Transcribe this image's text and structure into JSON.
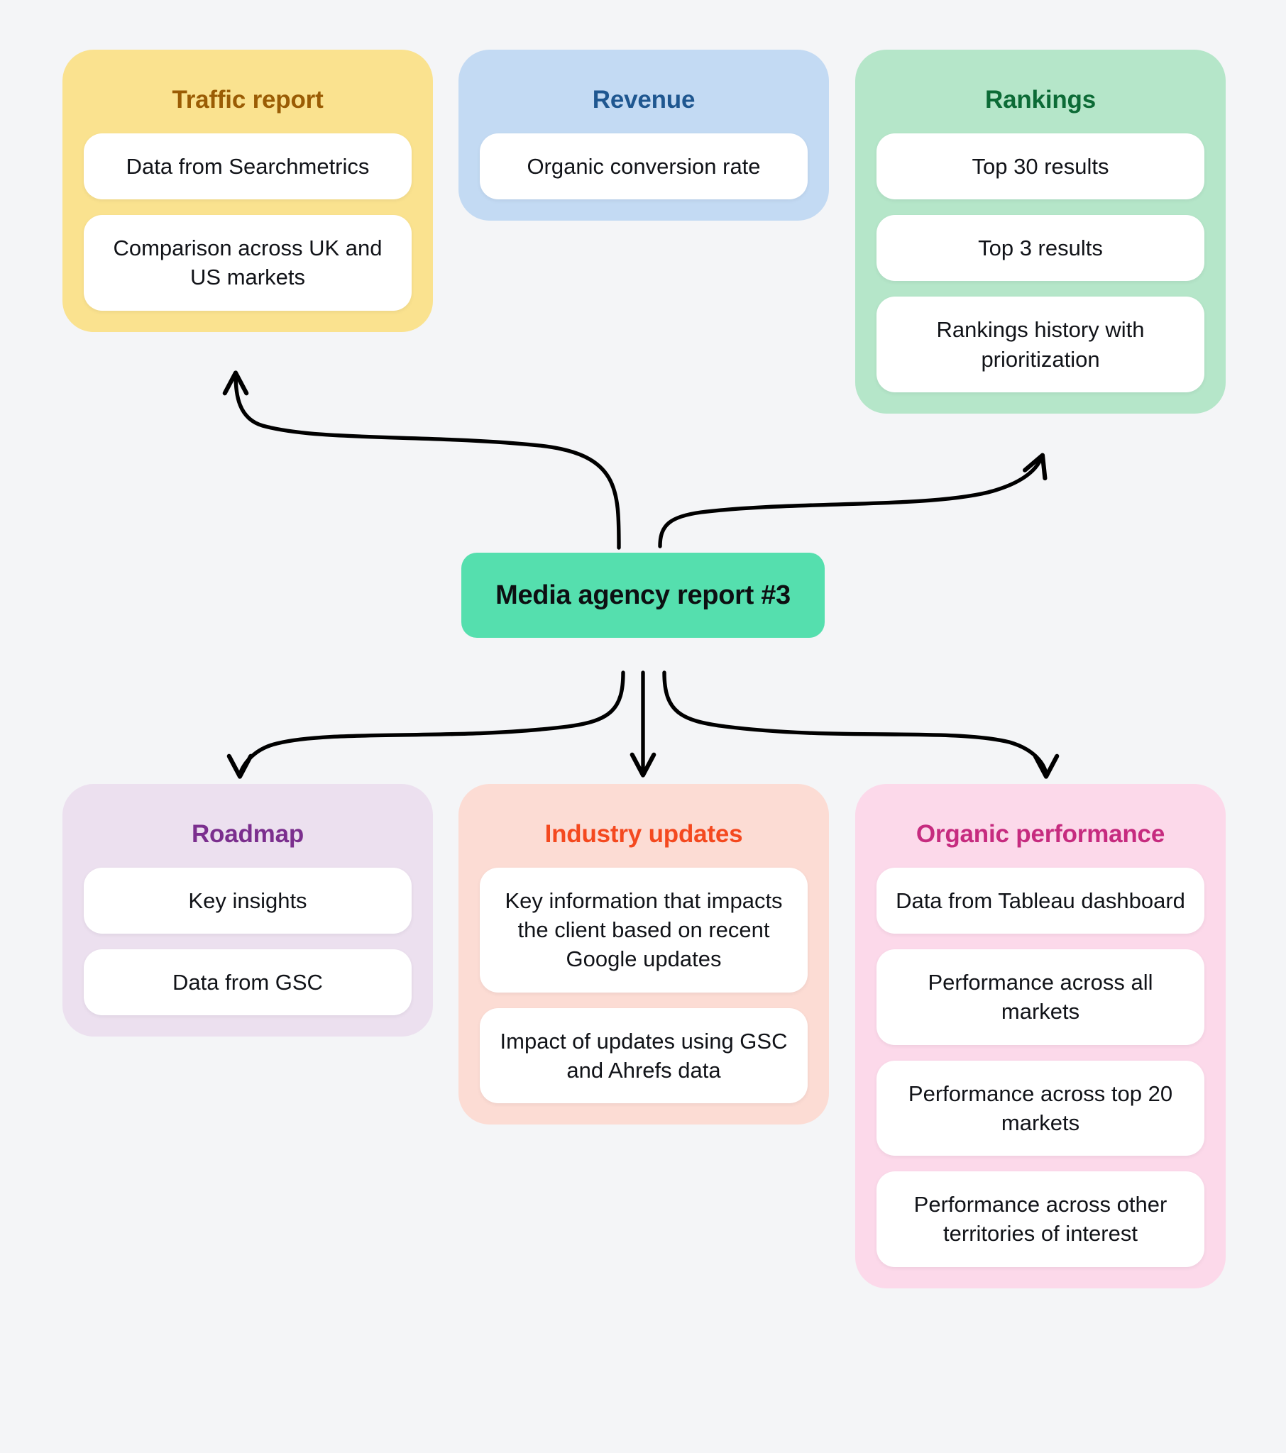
{
  "diagram": {
    "background_color": "#f4f5f7",
    "center": {
      "label": "Media agency report #3",
      "fill": "#55dfae",
      "text_color": "#0d0f12"
    },
    "arrow_color": "#000000",
    "groups": [
      {
        "id": "traffic",
        "title": "Traffic report",
        "fill": "#fae28f",
        "title_color": "#9a5c04",
        "items": [
          "Data from Searchmetrics",
          "Comparison across UK and US markets"
        ]
      },
      {
        "id": "revenue",
        "title": "Revenue",
        "fill": "#c3daf3",
        "title_color": "#1f5790",
        "items": [
          "Organic conversion rate"
        ]
      },
      {
        "id": "rankings",
        "title": "Rankings",
        "fill": "#b5e6c9",
        "title_color": "#0c6b36",
        "items": [
          "Top 30 results",
          "Top 3 results",
          "Rankings history with prioritization"
        ]
      },
      {
        "id": "roadmap",
        "title": "Roadmap",
        "fill": "#ece0ef",
        "title_color": "#7b2f8e",
        "items": [
          "Key insights",
          "Data from GSC"
        ]
      },
      {
        "id": "industry",
        "title": "Industry updates",
        "fill": "#fcdcd4",
        "title_color": "#f4491f",
        "items": [
          "Key information that impacts the client based on recent Google updates",
          "Impact of updates using GSC and Ahrefs data"
        ]
      },
      {
        "id": "organic",
        "title": "Organic performance",
        "fill": "#fcd9ea",
        "title_color": "#c62b7f",
        "items": [
          "Data from Tableau dashboard",
          "Performance across all markets",
          "Performance across top 20 markets",
          "Performance across other territories of interest"
        ]
      }
    ],
    "connections": [
      {
        "from": "center",
        "to": "traffic",
        "direction": "up-left"
      },
      {
        "from": "center",
        "to": "rankings",
        "direction": "up-right"
      },
      {
        "from": "center",
        "to": "roadmap",
        "direction": "down-left"
      },
      {
        "from": "center",
        "to": "industry",
        "direction": "down"
      },
      {
        "from": "center",
        "to": "organic",
        "direction": "down-right"
      }
    ]
  }
}
